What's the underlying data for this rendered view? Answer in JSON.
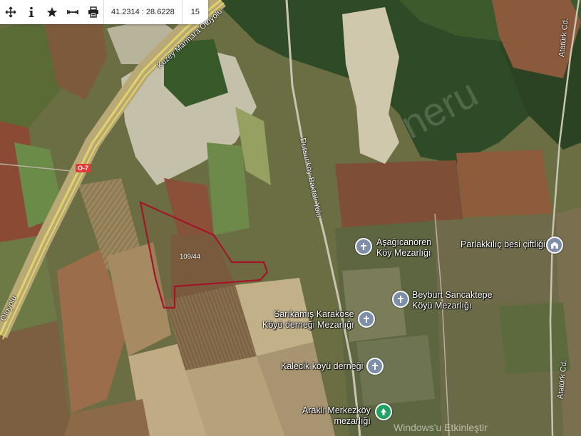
{
  "toolbar": {
    "coordinates": "41.2314 : 28.6228",
    "zoom": "15",
    "icons": [
      "crosshair-move-icon",
      "info-icon",
      "star-icon",
      "measure-icon",
      "print-icon"
    ]
  },
  "parcel": {
    "label": "109/44",
    "outline_color": "#a3142a"
  },
  "roads": {
    "motorway_name": "Kuzey Marmara Otoyolu",
    "motorway_name_lower": "Otoyolu",
    "motorway_shield": "O-7",
    "dursunkoy_road": "Dursunköy-Baktalı Yolu",
    "ataturk_upper": "Atatürk Cd.",
    "ataturk_lower": "Atatürk Cd."
  },
  "pois": [
    {
      "id": "asagicanoren",
      "line1": "Aşağıcanören",
      "line2": "Köy Mezarlığı",
      "icon": "cemetery-icon"
    },
    {
      "id": "parlakkilic",
      "line1": "Parlakkılıç besi çiftliği",
      "line2": "",
      "icon": "farm-icon"
    },
    {
      "id": "beyburt",
      "line1": "Beyburt Sancaktepe",
      "line2": "Köyü Mezarlığı",
      "icon": "cemetery-icon"
    },
    {
      "id": "sarikamis",
      "line1": "Sarıkamış Karaköse",
      "line2": "Köyü derneği Mezarlığı",
      "icon": "cemetery-icon"
    },
    {
      "id": "kalecik",
      "line1": "Kalecik köyü derneği",
      "line2": "",
      "icon": "cemetery-icon"
    },
    {
      "id": "arakli",
      "line1": "Araklı Merkezköy",
      "line2": "mezarlığı",
      "icon": "park-icon"
    }
  ],
  "watermark": {
    "os_text": "Windows'u Etkinleştir"
  },
  "colors": {
    "parcel": "#a3142a",
    "pin_gray": "#7d8fa8",
    "pin_green": "#1ea362"
  }
}
